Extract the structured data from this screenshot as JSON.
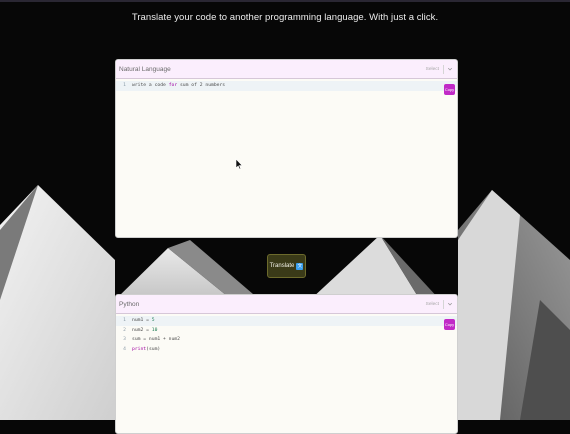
{
  "header": {
    "headline": "Translate your code to another programming language. With just a click."
  },
  "input_panel": {
    "title": "Natural Language",
    "select_label": "Select",
    "copy_label": "Copy",
    "lines": [
      {
        "num": "1",
        "parts": [
          {
            "t": "write a code ",
            "c": "plain"
          },
          {
            "t": "for",
            "c": "kw"
          },
          {
            "t": " sum of 2 numbers",
            "c": "plain"
          }
        ]
      }
    ]
  },
  "translate": {
    "label": "Translate",
    "icon": "language-icon"
  },
  "output_panel": {
    "title": "Python",
    "select_label": "Select",
    "copy_label": "Copy",
    "lines": [
      {
        "num": "1",
        "parts": [
          {
            "t": "num1 = ",
            "c": "plain"
          },
          {
            "t": "5",
            "c": "num"
          }
        ]
      },
      {
        "num": "2",
        "parts": [
          {
            "t": "num2 = ",
            "c": "plain"
          },
          {
            "t": "10",
            "c": "num"
          }
        ]
      },
      {
        "num": "3",
        "parts": [
          {
            "t": "sum = num1 + num2",
            "c": "plain"
          }
        ]
      },
      {
        "num": "4",
        "parts": [
          {
            "t": "print",
            "c": "kw"
          },
          {
            "t": "(sum)",
            "c": "plain"
          }
        ]
      }
    ]
  },
  "colors": {
    "panel_header": "#fbeefd",
    "copy_button": "#c12ac7",
    "translate_button": "#3a3a18",
    "background": "#070707"
  }
}
